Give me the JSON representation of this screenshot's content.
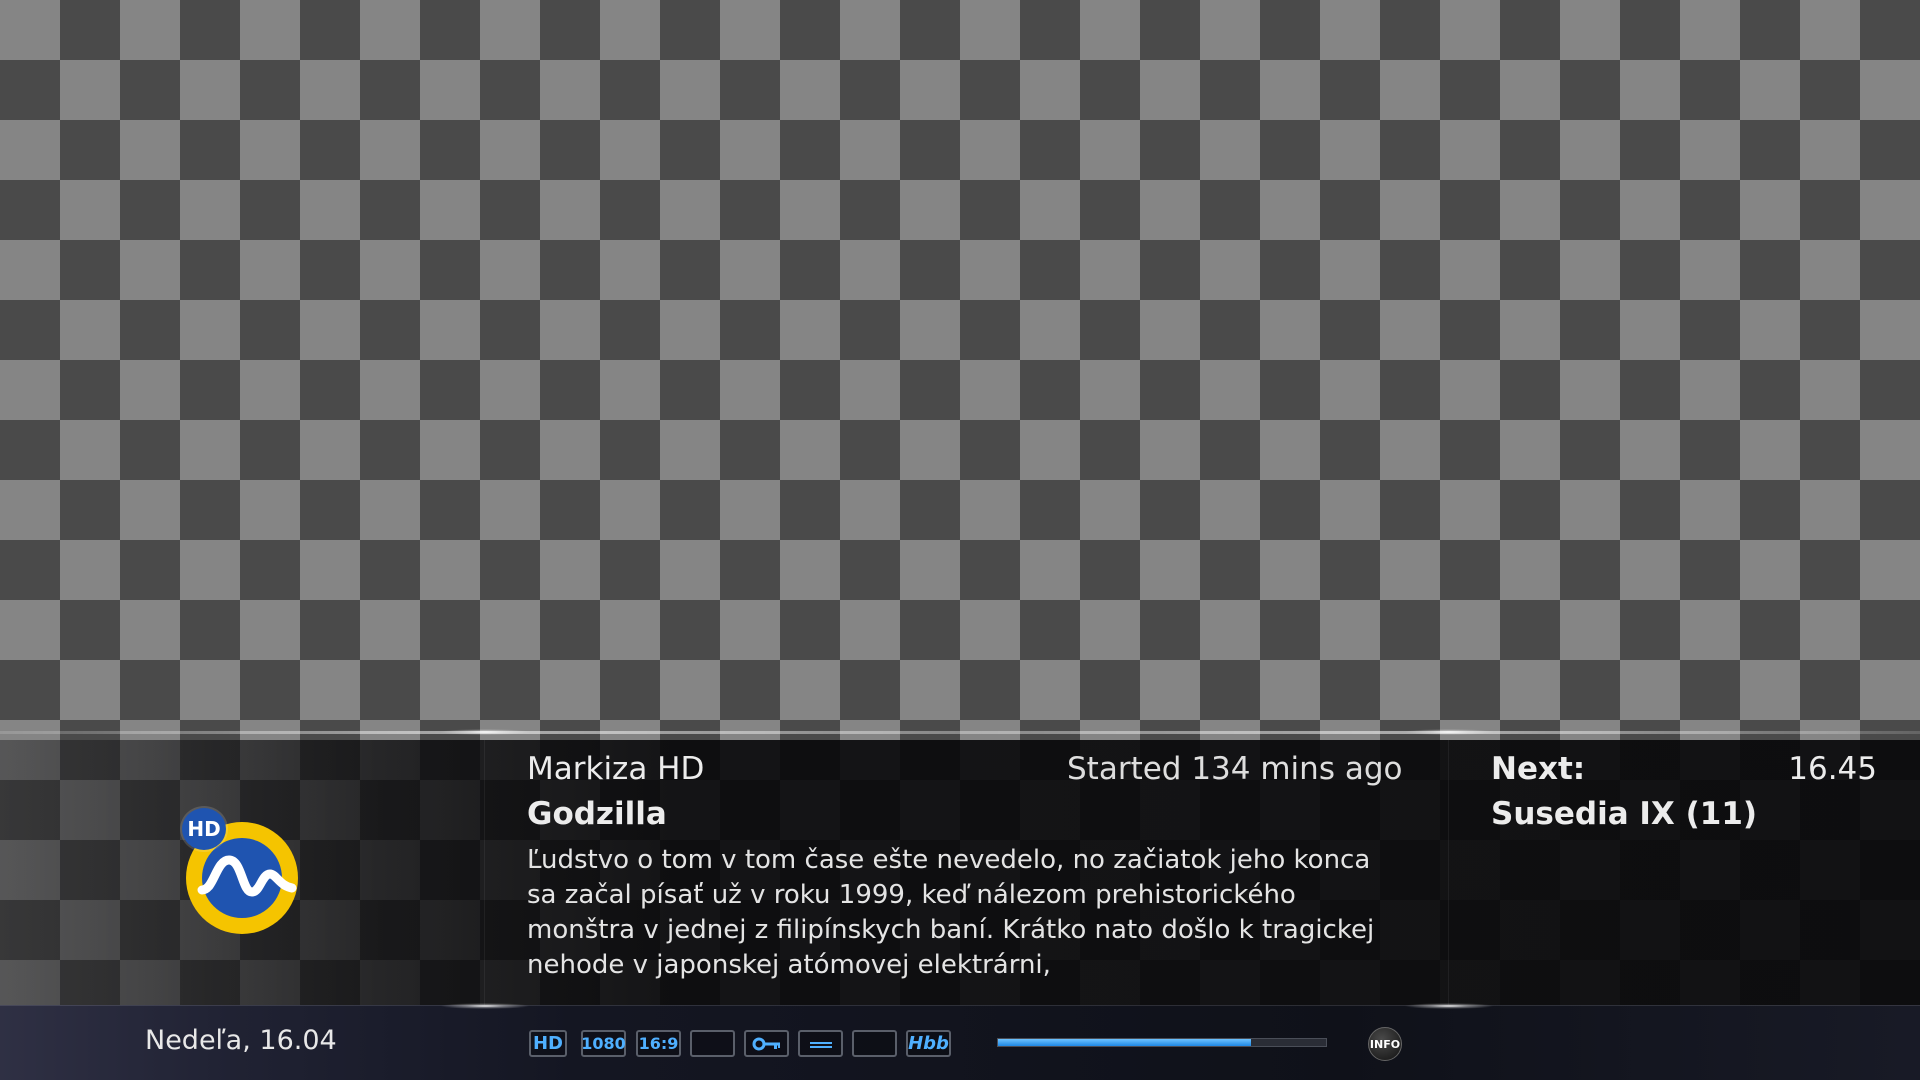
{
  "channel": {
    "name": "Markiza HD",
    "badge": "HD",
    "logo_icon": "markiza-logo-icon"
  },
  "current": {
    "title": "Godzilla",
    "started": "Started 134 mins ago",
    "progress": 0.77,
    "description": "Ľudstvo o tom v tom čase ešte nevedelo, no začiatok jeho konca sa začal písať už v roku 1999, keď nálezom prehistorického monštra v jednej z filipínskych baní. Krátko nato došlo k tragickej nehode v japonskej atómovej elektrárni,"
  },
  "next": {
    "label": "Next:",
    "time": "16.45",
    "title": "Susedia IX (11)"
  },
  "status_bar": {
    "date": "Nedeľa, 16.04",
    "badges": {
      "hd": "HD",
      "resolution": "1080",
      "aspect": "16:9",
      "hbbtv": "Hbb"
    },
    "info_label": "INFO"
  },
  "colors": {
    "accent": "#4fb0ff",
    "progress": "#1e88e5",
    "logo_yellow": "#f5c400",
    "logo_blue": "#1f54b0"
  }
}
